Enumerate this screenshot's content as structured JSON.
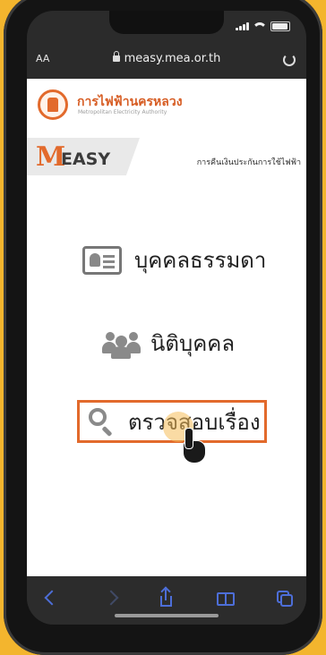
{
  "browser": {
    "text_size_label": "AA",
    "url": "measy.mea.or.th"
  },
  "site": {
    "org_name": "การไฟฟ้านครหลวง",
    "org_subtitle": "Metropolitan Electricity Authority",
    "brand_m": "M",
    "brand_rest": "EASY",
    "tagline": "การคืนเงินประกันการใช้ไฟฟ้า"
  },
  "menu": {
    "individual_label": "บุคคลธรรมดา",
    "juristic_label": "นิติบุคคล",
    "check_status_label": "ตรวจสอบเรื่อง"
  },
  "colors": {
    "accent": "#e26a2c",
    "toolbar_blue": "#4d6ed8"
  }
}
